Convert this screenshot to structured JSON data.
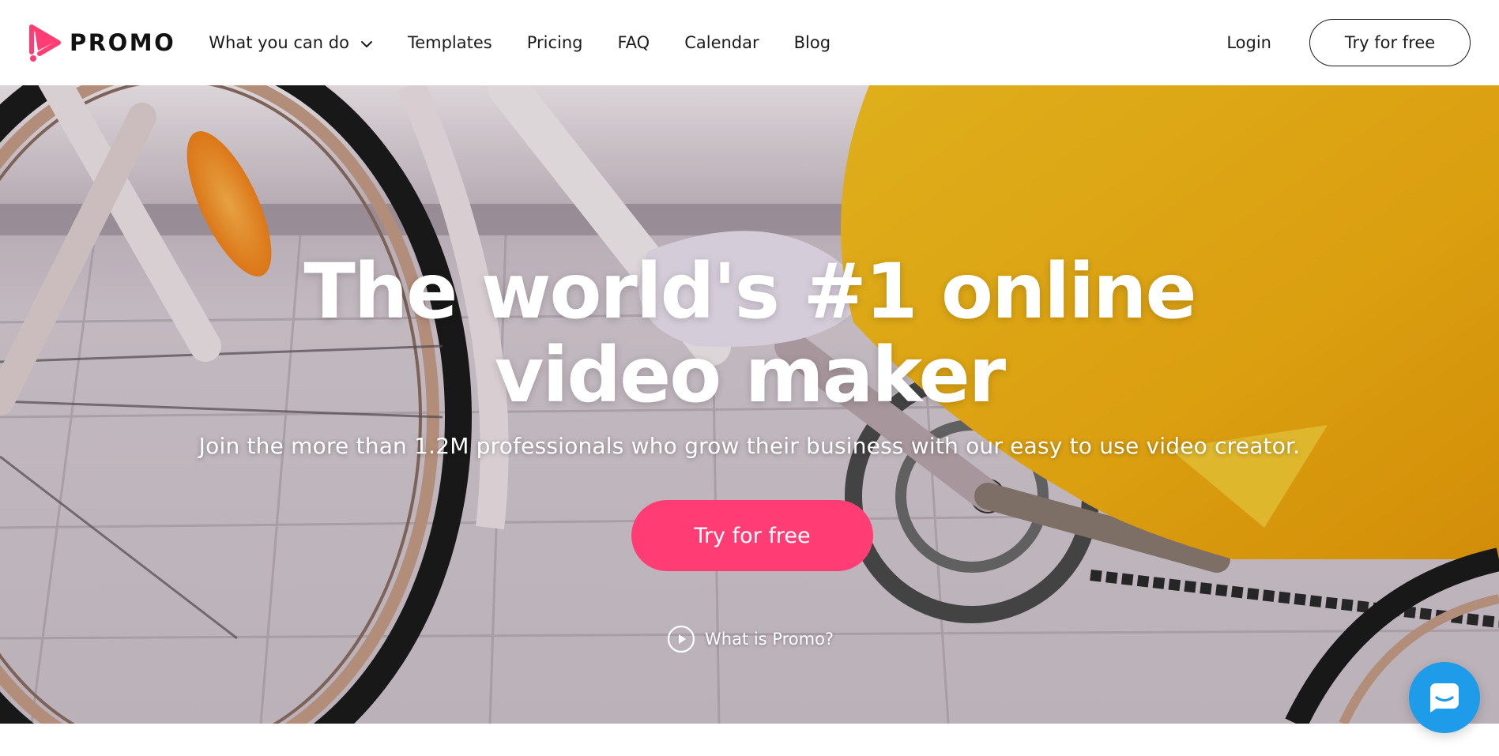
{
  "brand": {
    "name": "PROMO",
    "accent_color": "#ff3d74",
    "logo_icon": "play-triangle-logo-icon"
  },
  "nav": {
    "items": [
      {
        "label": "What you can do",
        "has_dropdown": true
      },
      {
        "label": "Templates"
      },
      {
        "label": "Pricing"
      },
      {
        "label": "FAQ"
      },
      {
        "label": "Calendar"
      },
      {
        "label": "Blog"
      }
    ],
    "login_label": "Login",
    "cta_label": "Try for free"
  },
  "hero": {
    "title_line1": "The world's #1 online",
    "title_line2": "video maker",
    "subtitle": "Join the more than 1.2M professionals who grow their business with our easy to use video creator.",
    "cta_label": "Try for free",
    "cta_color": "#ff3d74",
    "secondary_link": "What is Promo?",
    "secondary_icon": "play-circle-icon"
  },
  "chat": {
    "icon": "chat-bubble-icon",
    "color": "#1e9be9"
  }
}
